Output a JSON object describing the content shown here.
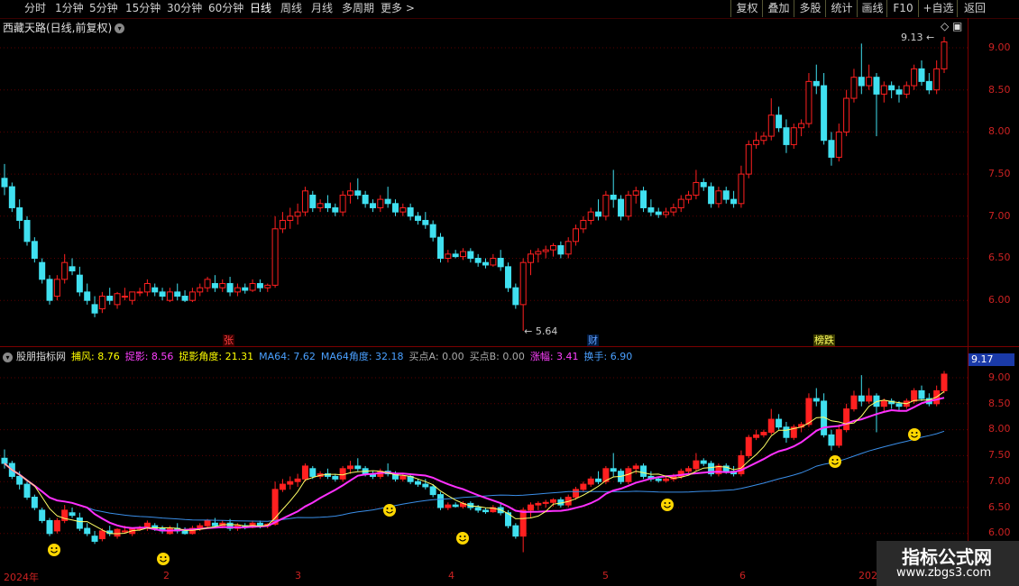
{
  "toolbar": {
    "periods": [
      "分时",
      "1分钟",
      "5分钟",
      "15分钟",
      "30分钟",
      "60分钟",
      "日线",
      "周线",
      "月线",
      "多周期",
      "更多 >"
    ],
    "active": "日线",
    "buttons": [
      "复权",
      "叠加",
      "多股",
      "统计",
      "画线",
      "F10",
      "+自选",
      "返回"
    ]
  },
  "upper": {
    "title": "西藏天路(日线,前复权)",
    "high_label": "9.13",
    "low_label": "5.64",
    "y_ticks": [
      "9.00",
      "8.50",
      "8.00",
      "7.50",
      "7.00",
      "6.50",
      "6.00"
    ],
    "events": [
      {
        "text": "张",
        "color": "#ff4040",
        "bg": "#3a0000"
      },
      {
        "text": "财",
        "color": "#60a0ff",
        "bg": "#001a40"
      },
      {
        "text": "榜跌",
        "color": "#ffff60",
        "bg": "#3a3a00"
      }
    ]
  },
  "lower": {
    "indicator_name": "股朋指标网",
    "labels": [
      {
        "text": "捕风: 8.76",
        "color": "#ffff00"
      },
      {
        "text": "捉影: 8.56",
        "color": "#ff40ff"
      },
      {
        "text": "捉影角度: 21.31",
        "color": "#ffff00"
      },
      {
        "text": "MA64: 7.62",
        "color": "#4aa0ff"
      },
      {
        "text": "MA64角度: 32.18",
        "color": "#4aa0ff"
      },
      {
        "text": "买点A: 0.00",
        "color": "#aaaaaa"
      },
      {
        "text": "买点B: 0.00",
        "color": "#aaaaaa"
      },
      {
        "text": "涨幅: 3.41",
        "color": "#ff40ff"
      },
      {
        "text": "换手: 6.90",
        "color": "#4aa0ff"
      }
    ],
    "price_box": "9.17",
    "y_ticks": [
      "9.00",
      "8.50",
      "8.00",
      "7.50",
      "7.00",
      "6.50",
      "6.00"
    ]
  },
  "x_axis": [
    "2024年",
    "2",
    "3",
    "4",
    "5",
    "6",
    "202"
  ],
  "watermark": {
    "title": "指标公式网",
    "url": "www.zbgs3.com"
  },
  "colors": {
    "up": "#ff2020",
    "down": "#40e0f0",
    "ma_yellow": "#ffff66",
    "ma_magenta": "#ff30ff",
    "ma_blue": "#3a8ee8"
  },
  "chart_data": {
    "type": "candlestick",
    "ylim": [
      5.5,
      9.2
    ],
    "candles": [
      [
        7.45,
        7.62,
        7.25,
        7.35
      ],
      [
        7.35,
        7.4,
        7.05,
        7.1
      ],
      [
        7.1,
        7.2,
        6.85,
        6.95
      ],
      [
        6.95,
        7.0,
        6.65,
        6.7
      ],
      [
        6.7,
        6.75,
        6.45,
        6.5
      ],
      [
        6.45,
        6.5,
        6.2,
        6.25
      ],
      [
        6.25,
        6.3,
        5.95,
        6.0
      ],
      [
        6.05,
        6.3,
        6.0,
        6.25
      ],
      [
        6.25,
        6.55,
        6.2,
        6.45
      ],
      [
        6.4,
        6.5,
        6.3,
        6.35
      ],
      [
        6.3,
        6.4,
        6.05,
        6.1
      ],
      [
        6.1,
        6.2,
        5.95,
        6.0
      ],
      [
        5.95,
        6.05,
        5.8,
        5.85
      ],
      [
        5.9,
        6.1,
        5.85,
        6.05
      ],
      [
        6.05,
        6.15,
        5.95,
        6.0
      ],
      [
        5.95,
        6.1,
        5.9,
        6.08
      ],
      [
        6.05,
        6.15,
        6.0,
        6.05
      ],
      [
        6.0,
        6.1,
        5.95,
        6.1
      ],
      [
        6.1,
        6.15,
        6.05,
        6.1
      ],
      [
        6.1,
        6.25,
        6.05,
        6.2
      ],
      [
        6.15,
        6.2,
        6.05,
        6.1
      ],
      [
        6.1,
        6.15,
        6.0,
        6.05
      ],
      [
        6.0,
        6.15,
        5.98,
        6.1
      ],
      [
        6.1,
        6.2,
        6.0,
        6.05
      ],
      [
        6.05,
        6.12,
        5.98,
        6.0
      ],
      [
        6.0,
        6.15,
        5.98,
        6.1
      ],
      [
        6.1,
        6.2,
        6.05,
        6.15
      ],
      [
        6.15,
        6.28,
        6.1,
        6.25
      ],
      [
        6.2,
        6.3,
        6.1,
        6.15
      ],
      [
        6.15,
        6.25,
        6.1,
        6.2
      ],
      [
        6.2,
        6.28,
        6.05,
        6.1
      ],
      [
        6.1,
        6.2,
        6.05,
        6.15
      ],
      [
        6.15,
        6.2,
        6.08,
        6.12
      ],
      [
        6.12,
        6.25,
        6.1,
        6.2
      ],
      [
        6.2,
        6.25,
        6.1,
        6.15
      ],
      [
        6.15,
        6.2,
        6.1,
        6.18
      ],
      [
        6.18,
        7.0,
        6.15,
        6.85
      ],
      [
        6.85,
        7.05,
        6.8,
        6.95
      ],
      [
        6.95,
        7.1,
        6.85,
        7.0
      ],
      [
        7.0,
        7.15,
        6.9,
        7.05
      ],
      [
        7.05,
        7.35,
        7.0,
        7.3
      ],
      [
        7.25,
        7.3,
        7.05,
        7.1
      ],
      [
        7.1,
        7.2,
        7.05,
        7.15
      ],
      [
        7.15,
        7.25,
        7.05,
        7.1
      ],
      [
        7.1,
        7.15,
        7.0,
        7.05
      ],
      [
        7.05,
        7.3,
        7.0,
        7.25
      ],
      [
        7.25,
        7.4,
        7.15,
        7.3
      ],
      [
        7.3,
        7.45,
        7.2,
        7.25
      ],
      [
        7.25,
        7.3,
        7.1,
        7.15
      ],
      [
        7.15,
        7.2,
        7.05,
        7.1
      ],
      [
        7.1,
        7.25,
        7.05,
        7.2
      ],
      [
        7.2,
        7.35,
        7.1,
        7.15
      ],
      [
        7.15,
        7.2,
        7.0,
        7.05
      ],
      [
        7.05,
        7.15,
        7.0,
        7.1
      ],
      [
        7.1,
        7.15,
        6.95,
        7.0
      ],
      [
        7.0,
        7.05,
        6.9,
        6.95
      ],
      [
        6.95,
        7.05,
        6.85,
        6.9
      ],
      [
        6.9,
        6.95,
        6.7,
        6.75
      ],
      [
        6.75,
        6.8,
        6.45,
        6.5
      ],
      [
        6.5,
        6.6,
        6.45,
        6.55
      ],
      [
        6.55,
        6.6,
        6.5,
        6.52
      ],
      [
        6.52,
        6.62,
        6.48,
        6.58
      ],
      [
        6.58,
        6.62,
        6.45,
        6.5
      ],
      [
        6.5,
        6.55,
        6.4,
        6.45
      ],
      [
        6.45,
        6.5,
        6.38,
        6.42
      ],
      [
        6.42,
        6.55,
        6.4,
        6.5
      ],
      [
        6.5,
        6.6,
        6.35,
        6.4
      ],
      [
        6.4,
        6.45,
        6.1,
        6.15
      ],
      [
        6.15,
        6.2,
        5.9,
        5.95
      ],
      [
        5.95,
        6.5,
        5.64,
        6.45
      ],
      [
        6.45,
        6.6,
        6.3,
        6.55
      ],
      [
        6.55,
        6.62,
        6.45,
        6.58
      ],
      [
        6.58,
        6.65,
        6.5,
        6.6
      ],
      [
        6.6,
        6.68,
        6.52,
        6.65
      ],
      [
        6.65,
        6.7,
        6.5,
        6.55
      ],
      [
        6.55,
        6.75,
        6.5,
        6.7
      ],
      [
        6.7,
        6.9,
        6.65,
        6.85
      ],
      [
        6.85,
        7.0,
        6.8,
        6.95
      ],
      [
        6.95,
        7.1,
        6.9,
        7.05
      ],
      [
        7.05,
        7.2,
        6.95,
        7.0
      ],
      [
        7.0,
        7.3,
        6.95,
        7.25
      ],
      [
        7.25,
        7.55,
        7.1,
        7.2
      ],
      [
        7.2,
        7.25,
        6.95,
        7.0
      ],
      [
        7.0,
        7.3,
        6.95,
        7.25
      ],
      [
        7.25,
        7.35,
        7.15,
        7.3
      ],
      [
        7.3,
        7.35,
        7.05,
        7.1
      ],
      [
        7.1,
        7.2,
        7.0,
        7.05
      ],
      [
        7.05,
        7.1,
        6.98,
        7.02
      ],
      [
        7.02,
        7.1,
        6.98,
        7.05
      ],
      [
        7.05,
        7.15,
        7.0,
        7.1
      ],
      [
        7.1,
        7.25,
        7.05,
        7.2
      ],
      [
        7.2,
        7.3,
        7.15,
        7.25
      ],
      [
        7.25,
        7.55,
        7.2,
        7.4
      ],
      [
        7.4,
        7.45,
        7.3,
        7.35
      ],
      [
        7.35,
        7.4,
        7.1,
        7.15
      ],
      [
        7.15,
        7.35,
        7.1,
        7.3
      ],
      [
        7.3,
        7.35,
        7.15,
        7.2
      ],
      [
        7.2,
        7.3,
        7.1,
        7.15
      ],
      [
        7.15,
        7.6,
        7.1,
        7.5
      ],
      [
        7.5,
        7.9,
        7.45,
        7.85
      ],
      [
        7.85,
        8.0,
        7.8,
        7.9
      ],
      [
        7.9,
        8.0,
        7.85,
        7.95
      ],
      [
        7.95,
        8.4,
        7.9,
        8.2
      ],
      [
        8.2,
        8.3,
        8.0,
        8.05
      ],
      [
        8.05,
        8.15,
        7.75,
        7.85
      ],
      [
        7.85,
        8.1,
        7.8,
        8.05
      ],
      [
        8.05,
        8.15,
        7.95,
        8.1
      ],
      [
        8.1,
        8.7,
        8.05,
        8.6
      ],
      [
        8.6,
        8.8,
        8.45,
        8.55
      ],
      [
        8.55,
        8.7,
        7.85,
        7.9
      ],
      [
        7.9,
        8.0,
        7.6,
        7.7
      ],
      [
        7.7,
        8.1,
        7.65,
        8.0
      ],
      [
        8.0,
        8.5,
        7.95,
        8.4
      ],
      [
        8.4,
        8.75,
        8.35,
        8.65
      ],
      [
        8.65,
        9.05,
        8.45,
        8.55
      ],
      [
        8.55,
        8.8,
        8.5,
        8.65
      ],
      [
        8.65,
        8.7,
        7.95,
        8.45
      ],
      [
        8.45,
        8.6,
        8.35,
        8.55
      ],
      [
        8.55,
        8.6,
        8.4,
        8.5
      ],
      [
        8.5,
        8.55,
        8.35,
        8.45
      ],
      [
        8.45,
        8.6,
        8.4,
        8.55
      ],
      [
        8.55,
        8.8,
        8.5,
        8.75
      ],
      [
        8.75,
        8.85,
        8.55,
        8.6
      ],
      [
        8.6,
        8.7,
        8.45,
        8.5
      ],
      [
        8.5,
        8.85,
        8.45,
        8.75
      ],
      [
        8.75,
        9.13,
        8.7,
        9.07
      ]
    ]
  }
}
